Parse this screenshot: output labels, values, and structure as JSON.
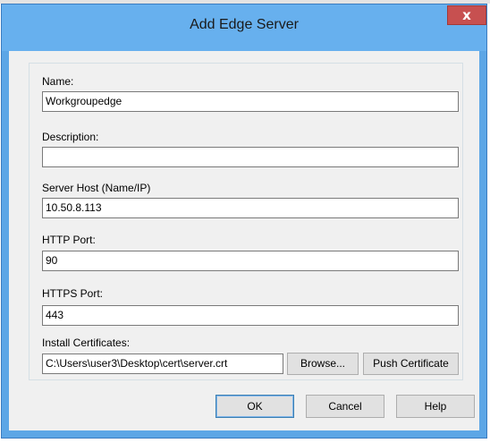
{
  "window": {
    "title": "Add Edge Server",
    "close_glyph": "x"
  },
  "form": {
    "name": {
      "label": "Name:",
      "value": "Workgroupedge"
    },
    "description": {
      "label": "Description:",
      "value": ""
    },
    "server_host": {
      "label": "Server Host (Name/IP)",
      "value": "10.50.8.113"
    },
    "http_port": {
      "label": "HTTP Port:",
      "value": "90"
    },
    "https_port": {
      "label": "HTTPS Port:",
      "value": "443"
    },
    "certificates": {
      "label": "Install Certificates:",
      "value": "C:\\Users\\user3\\Desktop\\cert\\server.crt",
      "browse_label": "Browse...",
      "push_label": "Push Certificate"
    }
  },
  "buttons": {
    "ok_label": "OK",
    "cancel_label": "Cancel",
    "help_label": "Help"
  },
  "colors": {
    "titlebar": "#67b0ee",
    "close_button": "#c75050",
    "client_background": "#f0f0f0"
  },
  "icons": {
    "close": "close-icon"
  }
}
